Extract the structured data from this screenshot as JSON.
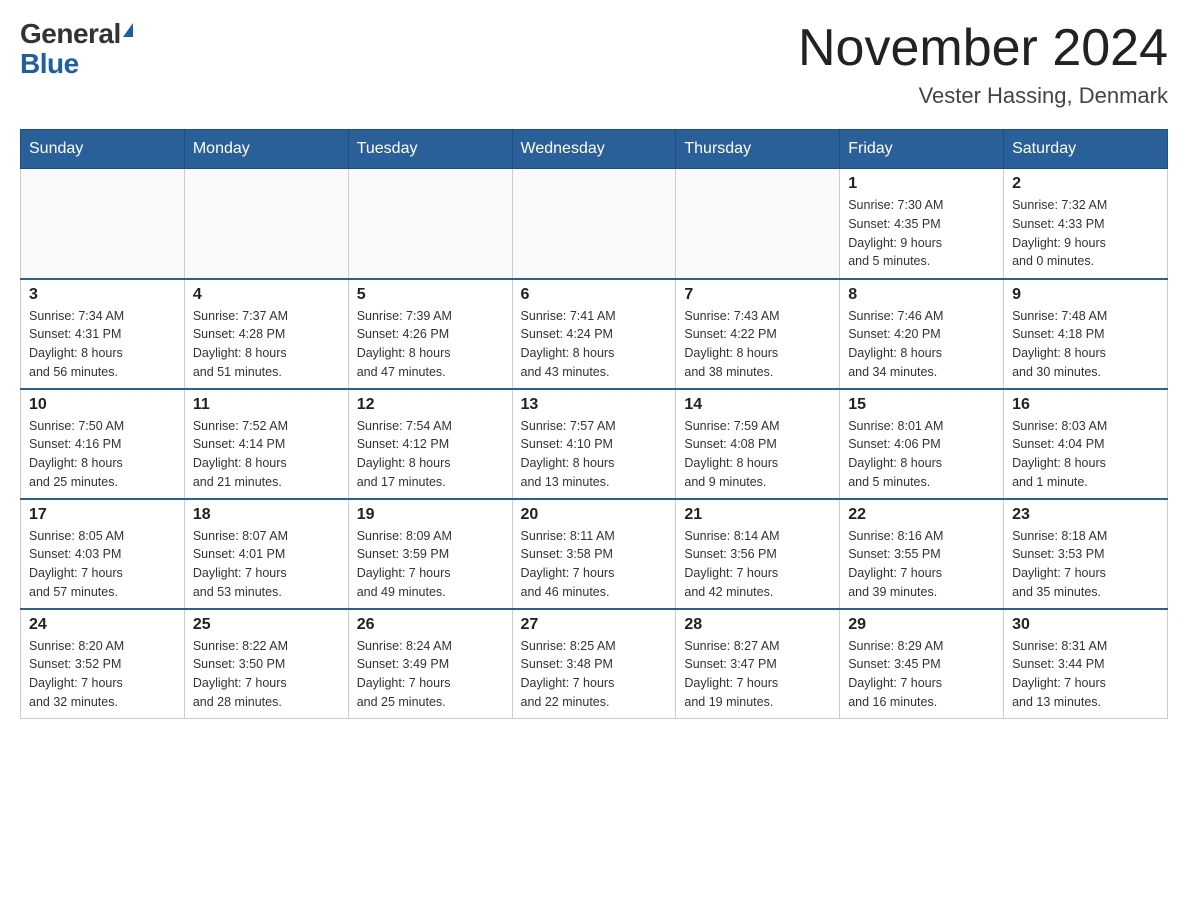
{
  "header": {
    "logo_general": "General",
    "logo_blue": "Blue",
    "title": "November 2024",
    "location": "Vester Hassing, Denmark"
  },
  "days_of_week": [
    "Sunday",
    "Monday",
    "Tuesday",
    "Wednesday",
    "Thursday",
    "Friday",
    "Saturday"
  ],
  "weeks": [
    [
      {
        "day": "",
        "info": ""
      },
      {
        "day": "",
        "info": ""
      },
      {
        "day": "",
        "info": ""
      },
      {
        "day": "",
        "info": ""
      },
      {
        "day": "",
        "info": ""
      },
      {
        "day": "1",
        "info": "Sunrise: 7:30 AM\nSunset: 4:35 PM\nDaylight: 9 hours\nand 5 minutes."
      },
      {
        "day": "2",
        "info": "Sunrise: 7:32 AM\nSunset: 4:33 PM\nDaylight: 9 hours\nand 0 minutes."
      }
    ],
    [
      {
        "day": "3",
        "info": "Sunrise: 7:34 AM\nSunset: 4:31 PM\nDaylight: 8 hours\nand 56 minutes."
      },
      {
        "day": "4",
        "info": "Sunrise: 7:37 AM\nSunset: 4:28 PM\nDaylight: 8 hours\nand 51 minutes."
      },
      {
        "day": "5",
        "info": "Sunrise: 7:39 AM\nSunset: 4:26 PM\nDaylight: 8 hours\nand 47 minutes."
      },
      {
        "day": "6",
        "info": "Sunrise: 7:41 AM\nSunset: 4:24 PM\nDaylight: 8 hours\nand 43 minutes."
      },
      {
        "day": "7",
        "info": "Sunrise: 7:43 AM\nSunset: 4:22 PM\nDaylight: 8 hours\nand 38 minutes."
      },
      {
        "day": "8",
        "info": "Sunrise: 7:46 AM\nSunset: 4:20 PM\nDaylight: 8 hours\nand 34 minutes."
      },
      {
        "day": "9",
        "info": "Sunrise: 7:48 AM\nSunset: 4:18 PM\nDaylight: 8 hours\nand 30 minutes."
      }
    ],
    [
      {
        "day": "10",
        "info": "Sunrise: 7:50 AM\nSunset: 4:16 PM\nDaylight: 8 hours\nand 25 minutes."
      },
      {
        "day": "11",
        "info": "Sunrise: 7:52 AM\nSunset: 4:14 PM\nDaylight: 8 hours\nand 21 minutes."
      },
      {
        "day": "12",
        "info": "Sunrise: 7:54 AM\nSunset: 4:12 PM\nDaylight: 8 hours\nand 17 minutes."
      },
      {
        "day": "13",
        "info": "Sunrise: 7:57 AM\nSunset: 4:10 PM\nDaylight: 8 hours\nand 13 minutes."
      },
      {
        "day": "14",
        "info": "Sunrise: 7:59 AM\nSunset: 4:08 PM\nDaylight: 8 hours\nand 9 minutes."
      },
      {
        "day": "15",
        "info": "Sunrise: 8:01 AM\nSunset: 4:06 PM\nDaylight: 8 hours\nand 5 minutes."
      },
      {
        "day": "16",
        "info": "Sunrise: 8:03 AM\nSunset: 4:04 PM\nDaylight: 8 hours\nand 1 minute."
      }
    ],
    [
      {
        "day": "17",
        "info": "Sunrise: 8:05 AM\nSunset: 4:03 PM\nDaylight: 7 hours\nand 57 minutes."
      },
      {
        "day": "18",
        "info": "Sunrise: 8:07 AM\nSunset: 4:01 PM\nDaylight: 7 hours\nand 53 minutes."
      },
      {
        "day": "19",
        "info": "Sunrise: 8:09 AM\nSunset: 3:59 PM\nDaylight: 7 hours\nand 49 minutes."
      },
      {
        "day": "20",
        "info": "Sunrise: 8:11 AM\nSunset: 3:58 PM\nDaylight: 7 hours\nand 46 minutes."
      },
      {
        "day": "21",
        "info": "Sunrise: 8:14 AM\nSunset: 3:56 PM\nDaylight: 7 hours\nand 42 minutes."
      },
      {
        "day": "22",
        "info": "Sunrise: 8:16 AM\nSunset: 3:55 PM\nDaylight: 7 hours\nand 39 minutes."
      },
      {
        "day": "23",
        "info": "Sunrise: 8:18 AM\nSunset: 3:53 PM\nDaylight: 7 hours\nand 35 minutes."
      }
    ],
    [
      {
        "day": "24",
        "info": "Sunrise: 8:20 AM\nSunset: 3:52 PM\nDaylight: 7 hours\nand 32 minutes."
      },
      {
        "day": "25",
        "info": "Sunrise: 8:22 AM\nSunset: 3:50 PM\nDaylight: 7 hours\nand 28 minutes."
      },
      {
        "day": "26",
        "info": "Sunrise: 8:24 AM\nSunset: 3:49 PM\nDaylight: 7 hours\nand 25 minutes."
      },
      {
        "day": "27",
        "info": "Sunrise: 8:25 AM\nSunset: 3:48 PM\nDaylight: 7 hours\nand 22 minutes."
      },
      {
        "day": "28",
        "info": "Sunrise: 8:27 AM\nSunset: 3:47 PM\nDaylight: 7 hours\nand 19 minutes."
      },
      {
        "day": "29",
        "info": "Sunrise: 8:29 AM\nSunset: 3:45 PM\nDaylight: 7 hours\nand 16 minutes."
      },
      {
        "day": "30",
        "info": "Sunrise: 8:31 AM\nSunset: 3:44 PM\nDaylight: 7 hours\nand 13 minutes."
      }
    ]
  ]
}
